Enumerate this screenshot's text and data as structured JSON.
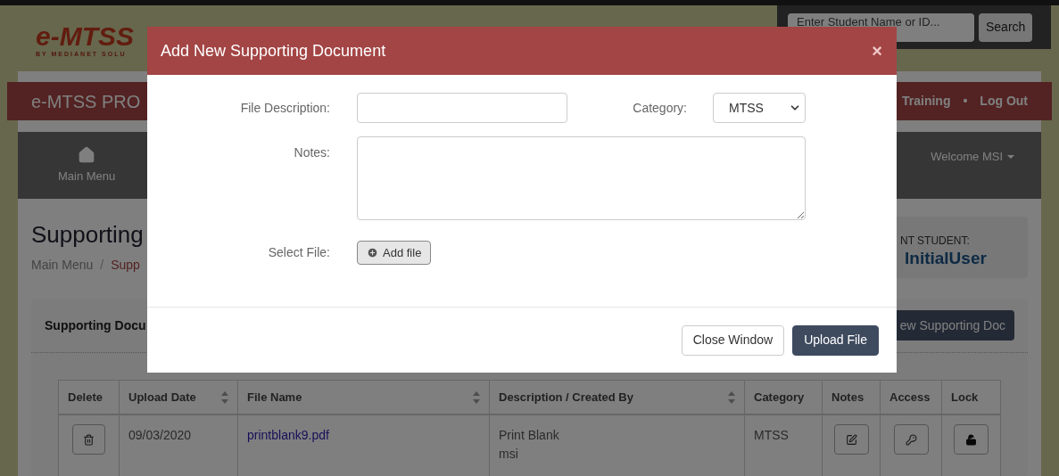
{
  "header": {
    "logo": "e-MTSS",
    "logo_tagline": "BY MEDIANET SOLU",
    "search": {
      "placeholder": "Enter Student Name or ID..."
    },
    "search_button": "Search"
  },
  "title_bar": {
    "title": "e-MTSS PRO",
    "links": [
      "Training",
      "Log Out"
    ],
    "separator": "•"
  },
  "nav": {
    "items": [
      {
        "label": "Main Menu"
      }
    ],
    "welcome": "Welcome MSI"
  },
  "page": {
    "heading": "Supporting",
    "breadcrumb": [
      "Main Menu",
      "Supp"
    ],
    "breadcrumb_separator": "/"
  },
  "student_card": {
    "label": "NT STUDENT:",
    "name": "InitialUser"
  },
  "panel": {
    "title": "Supporting Docu",
    "add_button": "ew Supporting Doc"
  },
  "table": {
    "columns": [
      {
        "label": "Delete",
        "sortable": false
      },
      {
        "label": "Upload Date",
        "sortable": true
      },
      {
        "label": "File Name",
        "sortable": true
      },
      {
        "label": "Description / Created By",
        "sortable": true
      },
      {
        "label": "Category",
        "sortable": false
      },
      {
        "label": "Notes",
        "sortable": false
      },
      {
        "label": "Access",
        "sortable": false
      },
      {
        "label": "Lock",
        "sortable": false
      }
    ],
    "rows": [
      {
        "upload_date": "09/03/2020",
        "file_name": "printblank9.pdf",
        "description": "Print Blank",
        "created_by": "msi",
        "category": "MTSS",
        "locked": false
      }
    ]
  },
  "modal": {
    "title": "Add New Supporting Document",
    "close": "×",
    "fields": [
      {
        "kind": "text",
        "label": "File Description:"
      },
      {
        "kind": "select",
        "label": "Category:",
        "value": "MTSS"
      },
      {
        "kind": "textarea",
        "label": "Notes:"
      },
      {
        "kind": "file",
        "label": "Select File:",
        "button": "Add file"
      }
    ],
    "buttons": [
      {
        "label": "Close Window",
        "primary": false
      },
      {
        "label": "Upload File",
        "primary": true
      }
    ]
  }
}
